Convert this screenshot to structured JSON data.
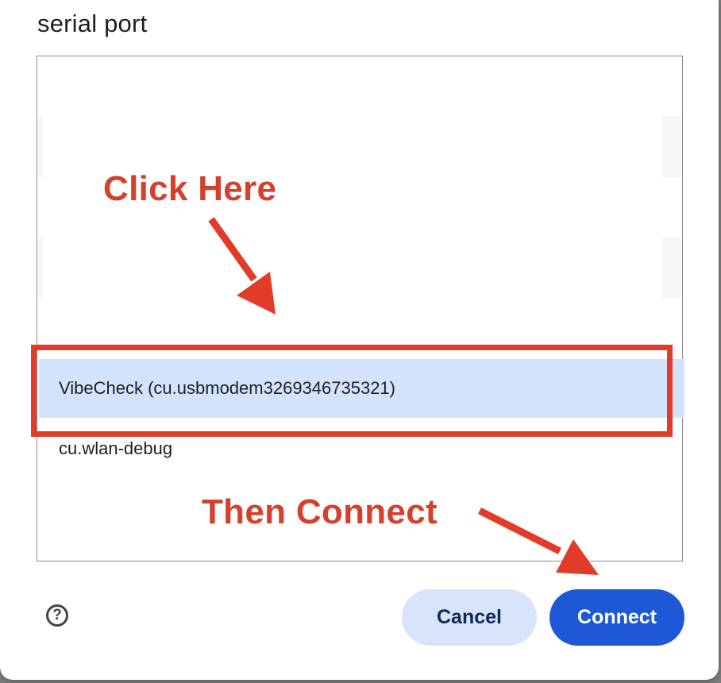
{
  "dialog": {
    "title": "serial port",
    "ports": [
      {
        "label": "VibeCheck (cu.usbmodem3269346735321)",
        "selected": true
      },
      {
        "label": "cu.wlan-debug",
        "selected": false
      }
    ],
    "help_icon": "question-circle-icon",
    "cancel_label": "Cancel",
    "connect_label": "Connect"
  },
  "annotations": {
    "click_here": "Click Here",
    "then_connect": "Then Connect",
    "color": "#e33b2a"
  },
  "colors": {
    "selected_row": "#d3e3fd",
    "connect_button": "#1e58d6",
    "cancel_button": "#d8e4fa"
  }
}
